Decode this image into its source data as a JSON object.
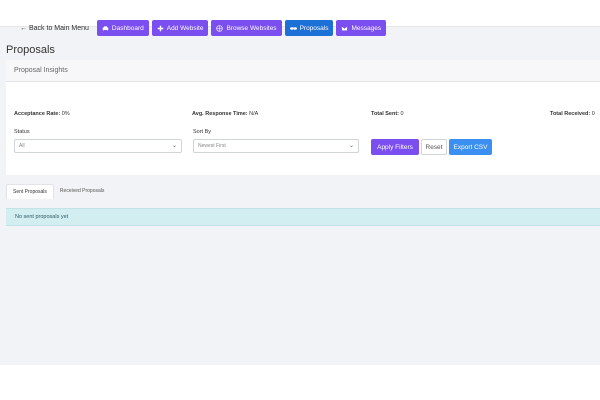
{
  "nav": {
    "back_label": "Back to Main Menu",
    "buttons": [
      {
        "label": "Dashboard",
        "icon": "car-icon",
        "active": false
      },
      {
        "label": "Add Website",
        "icon": "plus-icon",
        "active": false
      },
      {
        "label": "Browse Websites",
        "icon": "globe-icon",
        "active": false
      },
      {
        "label": "Proposals",
        "icon": "handshake-icon",
        "active": true
      },
      {
        "label": "Messages",
        "icon": "envelope-icon",
        "active": false
      }
    ]
  },
  "page_title": "Proposals",
  "insights": {
    "header": "Proposal Insights",
    "acceptance_label": "Acceptance Rate:",
    "acceptance_value": "0%",
    "response_label": "Avg. Response Time:",
    "response_value": "N/A",
    "sent_label": "Total Sent:",
    "sent_value": "0",
    "received_label": "Total Received:",
    "received_value": "0"
  },
  "filters": {
    "status_label": "Status",
    "status_value": "All",
    "sort_label": "Sort By",
    "sort_value": "Newest First",
    "apply_label": "Apply Filters",
    "reset_label": "Reset",
    "export_label": "Export CSV"
  },
  "tabs": [
    {
      "label": "Sent Proposals",
      "active": true
    },
    {
      "label": "Received Proposals",
      "active": false
    }
  ],
  "notice": "No sent proposals yet",
  "colors": {
    "primary_purple": "#7b4ef0",
    "active_blue": "#1d70d6",
    "export_blue": "#3a8ff0",
    "notice_bg": "#d3eef1"
  }
}
